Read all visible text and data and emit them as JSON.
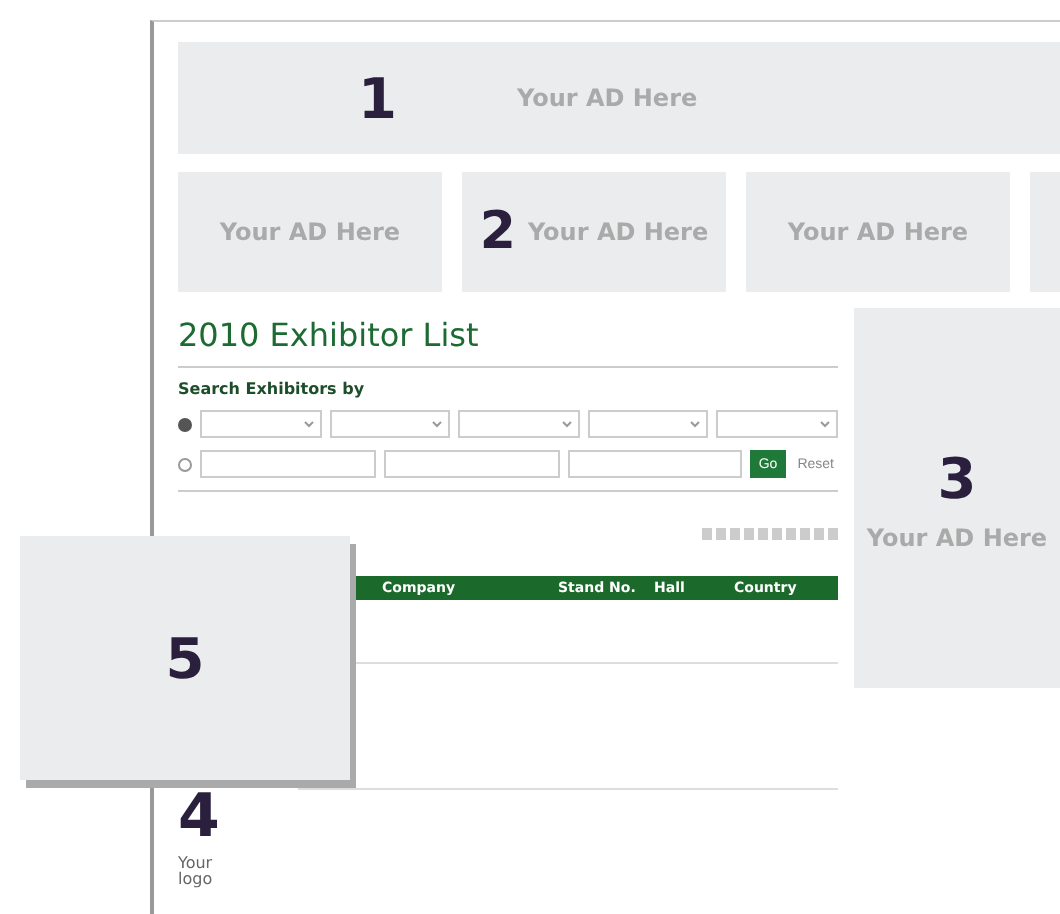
{
  "top_banner": {
    "number": "1",
    "headline": "Your AD Here"
  },
  "ad_row": [
    {
      "headline": "Your AD Here"
    },
    {
      "number": "2",
      "headline": "Your AD Here"
    },
    {
      "headline": "Your AD Here"
    }
  ],
  "title": "2010 Exhibitor List",
  "search": {
    "heading": "Search Exhibitors by",
    "modes": [
      {
        "selected": true
      },
      {
        "selected": false
      }
    ],
    "go": "Go",
    "reset": "Reset"
  },
  "side_ad": {
    "number": "3",
    "headline": "Your AD Here"
  },
  "table": {
    "columns": [
      "Company",
      "Stand No.",
      "Hall",
      "Country"
    ]
  },
  "logo_row": {
    "number": "4",
    "logo_text": "Your logo"
  },
  "overlay_ad": {
    "number": "5"
  }
}
